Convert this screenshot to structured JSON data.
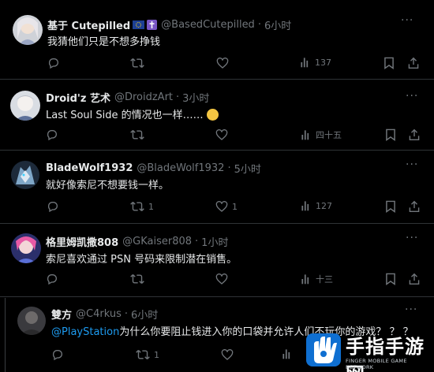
{
  "tweets": [
    {
      "name": "基于 Cutepilled",
      "handle": "@BasedCutepilled",
      "time": "6小时",
      "text": "我猜他们只是不想多挣钱",
      "views": "137",
      "replies": "",
      "retweets": "",
      "likes": ""
    },
    {
      "name": "Droid'z 艺术",
      "handle": "@DroidzArt",
      "time": "3小时",
      "text": "Last Soul Side 的情况也一样……",
      "emoji": "🙁",
      "views": "四十五",
      "replies": "",
      "retweets": "",
      "likes": ""
    },
    {
      "name": "BladeWolf1932",
      "handle": "@BladeWolf1932",
      "time": "5小时",
      "text": "就好像索尼不想要钱一样。",
      "views": "127",
      "replies": "",
      "retweets": "1",
      "likes": "1"
    },
    {
      "name": "格里姆凯撒808",
      "handle": "@GKaiser808",
      "time": "1小时",
      "text": "索尼喜欢通过 PSN 号码来限制潜在销售。",
      "views": "十三",
      "replies": "",
      "retweets": "",
      "likes": ""
    },
    {
      "name": "雙方",
      "handle": "@C4rkus",
      "time": "6小时",
      "mention": "@PlayStation",
      "text": "为什么你要阻止钱进入你的口袋并允许人们不玩你的游戏？ ？ ？",
      "views": "",
      "replies": "",
      "retweets": "1",
      "likes": ""
    }
  ],
  "separator": "·",
  "more_label": "···",
  "watermark": {
    "title": "手指手游网",
    "subtitle": "FINGER MOBILE GAME NETWORK"
  },
  "colors": {
    "background": "#000000",
    "text": "#e7e9ea",
    "muted": "#71767b",
    "link": "#1d9bf0",
    "separator": "#2f3336"
  },
  "icons": {
    "reply": "reply-icon",
    "retweet": "retweet-icon",
    "like": "heart-icon",
    "views": "analytics-icon",
    "bookmark": "bookmark-icon",
    "share": "share-icon",
    "more": "more-icon",
    "eu_flag": "eu-flag-icon",
    "cross": "cross-icon"
  }
}
